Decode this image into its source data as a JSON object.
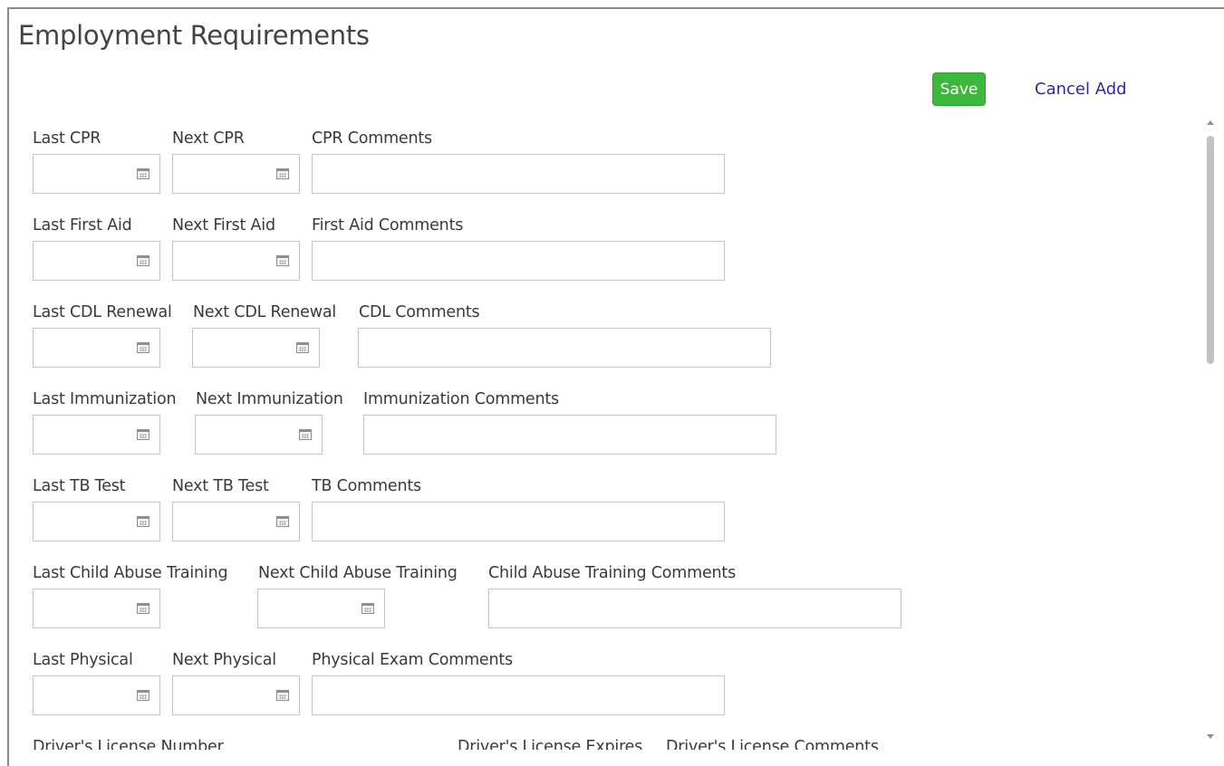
{
  "header": {
    "title": "Employment Requirements",
    "save_label": "Save",
    "cancel_label": "Cancel Add"
  },
  "colors": {
    "save_button": "#3cb93c",
    "cancel_link": "#2a2aa8"
  },
  "rows": [
    {
      "last_label": "Last CPR",
      "next_label": "Next CPR",
      "comment_label": "CPR Comments"
    },
    {
      "last_label": "Last First Aid",
      "next_label": "Next First Aid",
      "comment_label": "First Aid Comments"
    },
    {
      "last_label": "Last CDL Renewal",
      "next_label": "Next CDL Renewal",
      "comment_label": "CDL Comments"
    },
    {
      "last_label": "Last Immunization",
      "next_label": "Next Immunization",
      "comment_label": "Immunization Comments"
    },
    {
      "last_label": "Last TB Test",
      "next_label": "Next TB Test",
      "comment_label": "TB Comments"
    },
    {
      "last_label": "Last Child Abuse Training",
      "next_label": "Next Child Abuse Training",
      "comment_label": "Child Abuse Training Comments"
    },
    {
      "last_label": "Last Physical",
      "next_label": "Next Physical",
      "comment_label": "Physical Exam Comments"
    }
  ],
  "drivers_license": {
    "number_label": "Driver's License Number",
    "expires_label": "Driver's License Expires",
    "comments_label": "Driver's License Comments"
  },
  "icons": {
    "date_picker": "calendar-icon",
    "scroll_up": "scroll-up-arrow-icon",
    "scroll_down": "scroll-down-arrow-icon"
  }
}
